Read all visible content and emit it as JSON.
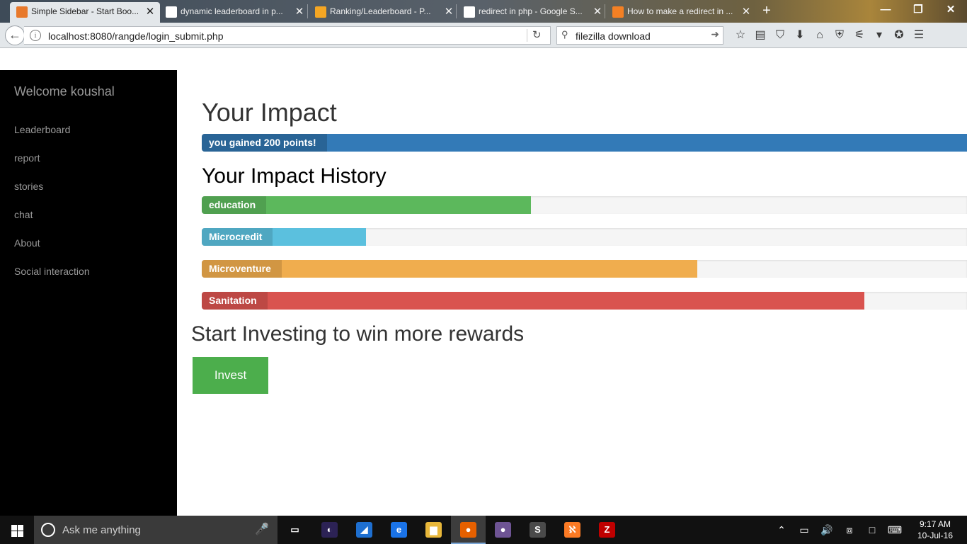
{
  "browser": {
    "tabs": [
      {
        "title": "Simple Sidebar - Start Boo...",
        "close": "✕",
        "favicon_color": "#e8792b",
        "active": true
      },
      {
        "title": "dynamic leaderboard in p...",
        "close": "✕",
        "favicon_color": "#ffffff",
        "active": false
      },
      {
        "title": "Ranking/Leaderboard - P...",
        "close": "✕",
        "favicon_color": "#f5a623",
        "active": false
      },
      {
        "title": "redirect in php - Google S...",
        "close": "✕",
        "favicon_color": "#ffffff",
        "active": false
      },
      {
        "title": "How to make a redirect in ...",
        "close": "✕",
        "favicon_color": "#f48024",
        "active": false
      }
    ],
    "new_tab": "+",
    "window_controls": {
      "minimize": "—",
      "restore": "❐",
      "close": "✕"
    },
    "url": "localhost:8080/rangde/login_submit.php",
    "search_value": "filezilla download",
    "toolbar_icons": [
      "star-icon",
      "reading-list-icon",
      "pocket-icon",
      "download-icon",
      "home-icon",
      "shield-icon",
      "sync-icon",
      "menu-arrow-icon",
      "addon-fox-icon",
      "hamburger-menu-icon"
    ]
  },
  "sidebar": {
    "title": "Welcome koushal",
    "links": [
      {
        "label": "Leaderboard"
      },
      {
        "label": "report"
      },
      {
        "label": "stories"
      },
      {
        "label": "chat"
      },
      {
        "label": "About"
      },
      {
        "label": "Social interaction"
      }
    ]
  },
  "main": {
    "impact_title": "Your Impact",
    "points_label": "you gained 200 points!",
    "history_title": "Your Impact History",
    "history": [
      {
        "label": "education",
        "value": 0.43,
        "color": "#5cb85c"
      },
      {
        "label": "Microcredit",
        "value": 0.215,
        "color": "#5bc0de"
      },
      {
        "label": "Microventure",
        "value": 0.648,
        "color": "#f0ad4e"
      },
      {
        "label": "Sanitation",
        "value": 0.866,
        "color": "#d9534f"
      }
    ],
    "cta_title": "Start Investing to win more rewards",
    "invest_label": "Invest"
  },
  "colors": {
    "primary_bar": "#337ab7",
    "sidebar_bg": "#000000",
    "invest_button": "#4cae4c"
  },
  "taskbar": {
    "search_placeholder": "Ask me anything",
    "apps": [
      {
        "name": "task-view-icon",
        "glyph": "▭",
        "bg": "transparent"
      },
      {
        "name": "eclipse-icon",
        "glyph": "◐",
        "bg": "#2c2255"
      },
      {
        "name": "app-triangle-icon",
        "glyph": "◢",
        "bg": "#1e6fd0"
      },
      {
        "name": "edge-icon",
        "glyph": "e",
        "bg": "#1a73e8"
      },
      {
        "name": "file-explorer-icon",
        "glyph": "▆",
        "bg": "#e8b73a"
      },
      {
        "name": "firefox-icon",
        "glyph": "●",
        "bg": "#e66000"
      },
      {
        "name": "github-icon",
        "glyph": "●",
        "bg": "#6e5494"
      },
      {
        "name": "sublime-icon",
        "glyph": "S",
        "bg": "#4a4a4a"
      },
      {
        "name": "xampp-icon",
        "glyph": "ℵ",
        "bg": "#fb7a24"
      },
      {
        "name": "filezilla-icon",
        "glyph": "Z",
        "bg": "#bf0000"
      }
    ],
    "time": "9:17 AM",
    "date": "10-Jul-16"
  }
}
